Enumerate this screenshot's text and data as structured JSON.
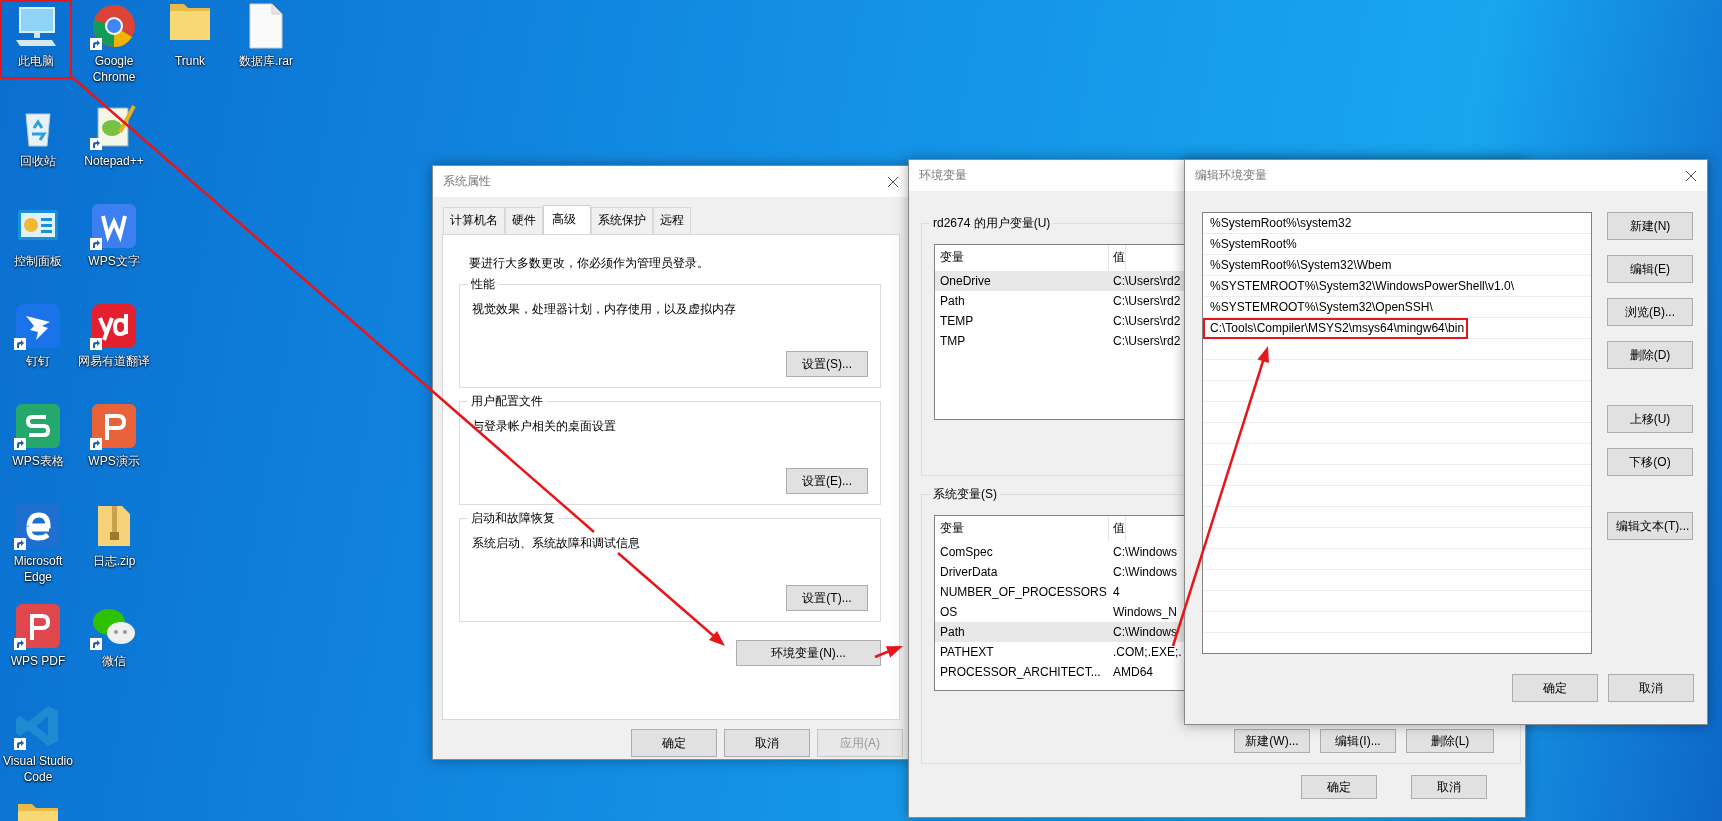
{
  "desktop": {
    "columns": [
      [
        {
          "kind": "computer",
          "label": "此电脑",
          "shortcut": false,
          "highlighted": true
        },
        {
          "kind": "recycle-bin",
          "label": "回收站",
          "shortcut": false,
          "highlighted": false
        },
        {
          "kind": "control-panel",
          "label": "控制面板",
          "shortcut": false,
          "highlighted": false
        },
        {
          "kind": "dingtalk",
          "label": "钉钉",
          "shortcut": true,
          "highlighted": false
        },
        {
          "kind": "wps-sheet",
          "label": "WPS表格",
          "shortcut": true,
          "highlighted": false
        },
        {
          "kind": "edge",
          "label": "Microsoft Edge",
          "shortcut": true,
          "highlighted": false
        },
        {
          "kind": "wps-pdf",
          "label": "WPS PDF",
          "shortcut": true,
          "highlighted": false
        },
        {
          "kind": "vscode",
          "label": "Visual Studio Code",
          "shortcut": true,
          "highlighted": false
        },
        {
          "kind": "folder",
          "highlighted": false
        }
      ],
      [
        {
          "kind": "chrome",
          "label": "Google Chrome",
          "shortcut": true,
          "highlighted": false
        },
        {
          "kind": "notepad",
          "label": "Notepad++",
          "shortcut": true,
          "highlighted": false
        },
        {
          "kind": "wps-writer",
          "label": "WPS文字",
          "shortcut": true,
          "highlighted": false
        },
        {
          "kind": "youdao",
          "label": "网易有道翻译",
          "shortcut": true,
          "highlighted": false
        },
        {
          "kind": "wps-present",
          "label": "WPS演示",
          "shortcut": true,
          "highlighted": false
        },
        {
          "kind": "zip",
          "label": "日志.zip",
          "shortcut": false,
          "highlighted": false
        },
        {
          "kind": "wechat",
          "label": "微信",
          "shortcut": true,
          "highlighted": false
        }
      ],
      [
        {
          "kind": "folder",
          "label": "Trunk",
          "shortcut": false,
          "highlighted": false
        }
      ],
      [
        {
          "kind": "file",
          "label": "数据库.rar",
          "shortcut": false,
          "highlighted": false
        }
      ]
    ]
  },
  "system_properties": {
    "title": "系统属性",
    "tabs": [
      {
        "label": "计算机名",
        "selected": false
      },
      {
        "label": "硬件",
        "selected": false
      },
      {
        "label": "高级",
        "selected": true
      },
      {
        "label": "系统保护",
        "selected": false
      },
      {
        "label": "远程",
        "selected": false
      }
    ],
    "notice": "要进行大多数更改，你必须作为管理员登录。",
    "groups": [
      {
        "title": "性能",
        "description": "视觉效果，处理器计划，内存使用，以及虚拟内存",
        "button": "设置(S)..."
      },
      {
        "title": "用户配置文件",
        "description": "与登录帐户相关的桌面设置",
        "button": "设置(E)..."
      },
      {
        "title": "启动和故障恢复",
        "description": "系统启动、系统故障和调试信息",
        "button": "设置(T)..."
      }
    ],
    "env_button": "环境变量(N)...",
    "buttons": [
      {
        "label": "确定",
        "disabled": false
      },
      {
        "label": "取消",
        "disabled": false
      },
      {
        "label": "应用(A)",
        "disabled": true
      }
    ]
  },
  "environment_variables": {
    "title": "环境变量",
    "user_group": {
      "title": "rd2674 的用户变量(U)",
      "columns": [
        "变量",
        "值"
      ],
      "rows": [
        {
          "name": "OneDrive",
          "value": "C:\\Users\\rd2",
          "selected": true
        },
        {
          "name": "Path",
          "value": "C:\\Users\\rd2",
          "selected": false
        },
        {
          "name": "TEMP",
          "value": "C:\\Users\\rd2",
          "selected": false
        },
        {
          "name": "TMP",
          "value": "C:\\Users\\rd2",
          "selected": false
        }
      ]
    },
    "system_group": {
      "title": "系统变量(S)",
      "columns": [
        "变量",
        "值"
      ],
      "rows": [
        {
          "name": "ComSpec",
          "value": "C:\\Windows",
          "selected": false
        },
        {
          "name": "DriverData",
          "value": "C:\\Windows",
          "selected": false
        },
        {
          "name": "NUMBER_OF_PROCESSORS",
          "value": "4",
          "selected": false
        },
        {
          "name": "OS",
          "value": "Windows_N",
          "selected": false
        },
        {
          "name": "Path",
          "value": "C:\\Windows",
          "selected": true
        },
        {
          "name": "PATHEXT",
          "value": ".COM;.EXE;.",
          "selected": false
        },
        {
          "name": "PROCESSOR_ARCHITECT...",
          "value": "AMD64",
          "selected": false
        }
      ],
      "buttons": [
        "新建(W)...",
        "编辑(I)...",
        "删除(L)"
      ]
    },
    "buttons": [
      "确定",
      "取消"
    ]
  },
  "edit_environment_variable": {
    "title": "编辑环境变量",
    "entries": [
      {
        "text": "%SystemRoot%\\system32",
        "highlighted": false
      },
      {
        "text": "%SystemRoot%",
        "highlighted": false
      },
      {
        "text": "%SystemRoot%\\System32\\Wbem",
        "highlighted": false
      },
      {
        "text": "%SYSTEMROOT%\\System32\\WindowsPowerShell\\v1.0\\",
        "highlighted": false
      },
      {
        "text": "%SYSTEMROOT%\\System32\\OpenSSH\\",
        "highlighted": false
      },
      {
        "text": "C:\\Tools\\Compiler\\MSYS2\\msys64\\mingw64\\bin",
        "highlighted": true
      }
    ],
    "side_buttons": [
      [
        "新建(N)",
        "编辑(E)",
        "浏览(B)...",
        "删除(D)"
      ],
      [
        "上移(U)",
        "下移(O)"
      ],
      [
        "编辑文本(T)..."
      ]
    ],
    "buttons": [
      "确定",
      "取消"
    ]
  }
}
